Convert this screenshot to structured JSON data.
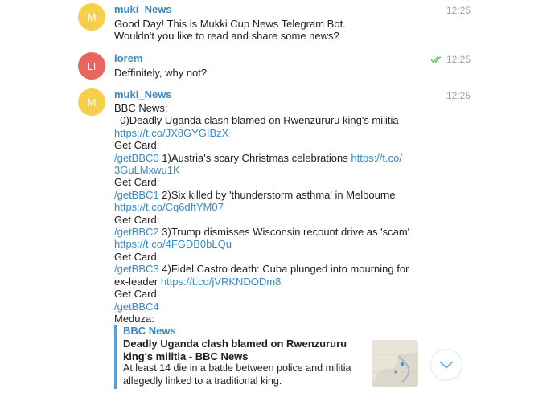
{
  "messages": [
    {
      "sender": "muki_News",
      "avatar_initials": "M",
      "avatar_color": "#f6cf4b",
      "time": "12:25",
      "lines": [
        "Good Day! This is Mukki Cup News Telegram Bot.",
        "Wouldn't you like to read and share some news?"
      ]
    },
    {
      "sender": "lorem",
      "avatar_initials": "LI",
      "avatar_color": "#e8665d",
      "time": "12:25",
      "read_icon": "double-check-icon",
      "lines": [
        "Deffinitely, why not?"
      ]
    },
    {
      "sender": "muki_News",
      "avatar_initials": "M",
      "avatar_color": "#f6cf4b",
      "time": "12:25",
      "body": {
        "l1": "BBC News:",
        "l2": "  0)Deadly Uganda clash blamed on Rwenzururu king's militia",
        "l3": "https://t.co/JX8GYGIBzX",
        "get_card": "Get Card:",
        "cmd0": "/getBBC0",
        "item1_text": " 1)Austria's scary Christmas celebrations ",
        "item1_link_a": "https://t.co/",
        "item1_link_b": "3GuLMxwu1K",
        "cmd1": "/getBBC1",
        "item2_text": " 2)Six killed by 'thunderstorm asthma' in Melbourne",
        "item2_link": "https://t.co/Cq6dftYM07",
        "cmd2": "/getBBC2",
        "item3_text": " 3)Trump dismisses Wisconsin recount drive as 'scam'",
        "item3_link": "https://t.co/4FGDB0bLQu",
        "cmd3": "/getBBC3",
        "item4_text": " 4)Fidel Castro death: Cuba plunged into mourning for",
        "item4_text_b": "ex-leader ",
        "item4_link": "https://t.co/jVRKNDODm8",
        "cmd4": "/getBBC4",
        "meduza": "Meduza:"
      },
      "preview": {
        "site": "BBC News",
        "title": "Deadly Uganda clash blamed on Rwenzururu king's militia - BBC News",
        "description": "At least 14 die in a battle between police and militia allegedly linked to a traditional king.",
        "thumbnail_icon": "map-thumbnail"
      }
    }
  ],
  "scroll_button_icon": "chevron-down-icon",
  "colors": {
    "link": "#3a8ac4",
    "check": "#4fc15a",
    "text": "#1f1f1f"
  }
}
